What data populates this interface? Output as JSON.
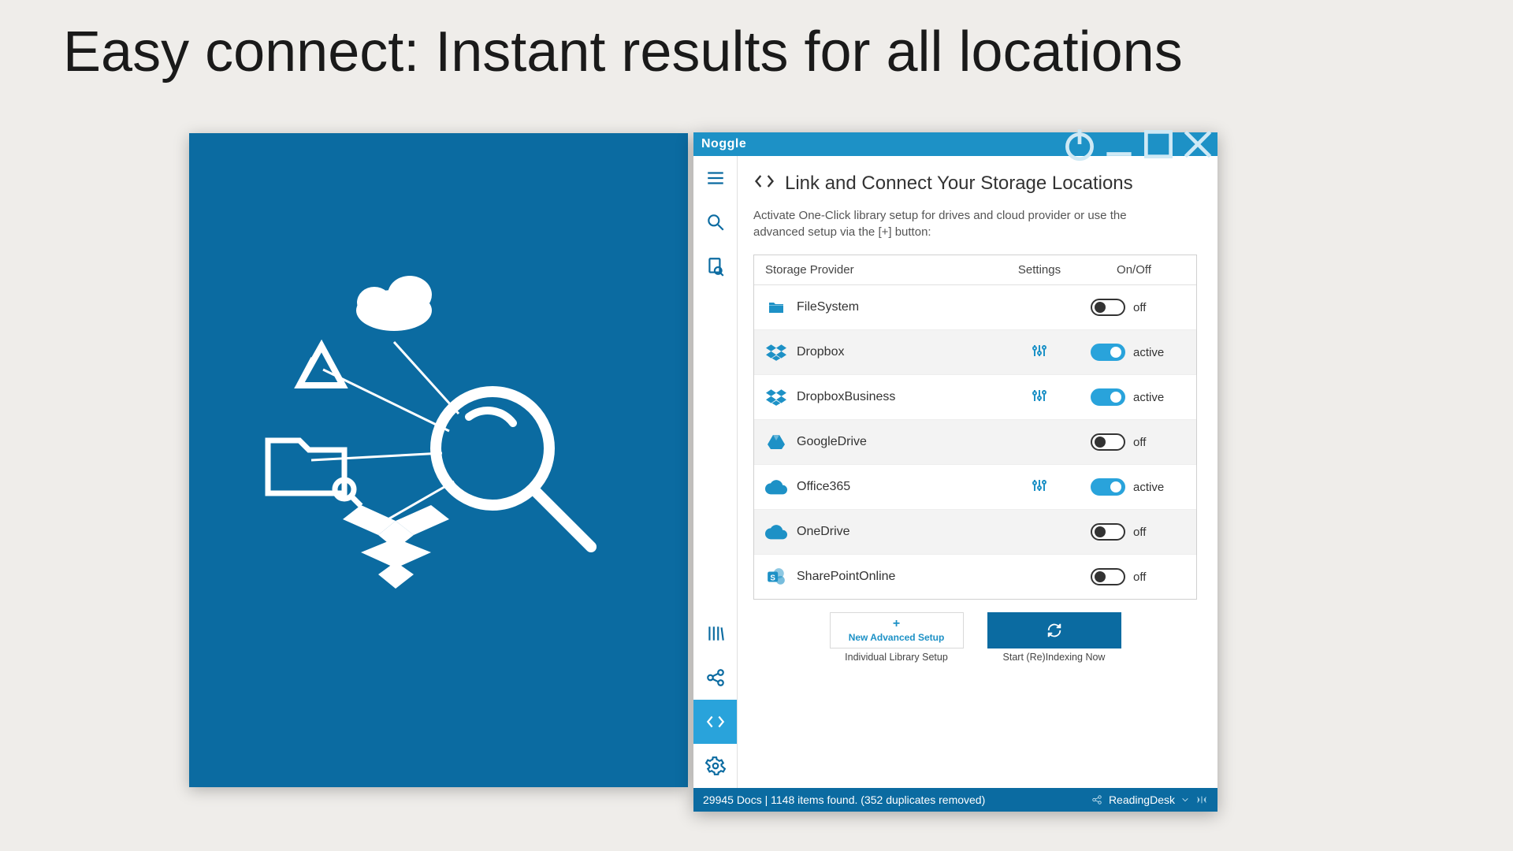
{
  "slide_title": "Easy connect: Instant results for all locations",
  "app_name": "Noggle",
  "page": {
    "title": "Link and Connect Your Storage Locations",
    "description": "Activate One-Click library setup for drives and cloud provider or use the advanced setup via the [+] button:"
  },
  "table": {
    "head": {
      "provider": "Storage Provider",
      "settings": "Settings",
      "onoff": "On/Off"
    },
    "rows": [
      {
        "name": "FileSystem",
        "icon": "folder",
        "settings": false,
        "active": false
      },
      {
        "name": "Dropbox",
        "icon": "dropbox",
        "settings": true,
        "active": true
      },
      {
        "name": "DropboxBusiness",
        "icon": "dropbox",
        "settings": true,
        "active": true
      },
      {
        "name": "GoogleDrive",
        "icon": "googledrive",
        "settings": false,
        "active": false
      },
      {
        "name": "Office365",
        "icon": "cloud",
        "settings": true,
        "active": true
      },
      {
        "name": "OneDrive",
        "icon": "cloud",
        "settings": false,
        "active": false
      },
      {
        "name": "SharePointOnline",
        "icon": "sharepoint",
        "settings": false,
        "active": false
      }
    ],
    "state_labels": {
      "on": "active",
      "off": "off"
    }
  },
  "actions": {
    "new_setup_label": "New Advanced Setup",
    "new_setup_caption": "Individual Library Setup",
    "reindex_caption": "Start (Re)Indexing Now"
  },
  "status": {
    "left": "29945 Docs | 1148 items found. (352 duplicates removed)",
    "right": "ReadingDesk"
  },
  "colors": {
    "brand": "#0b6ba1",
    "accent": "#29a3db"
  }
}
